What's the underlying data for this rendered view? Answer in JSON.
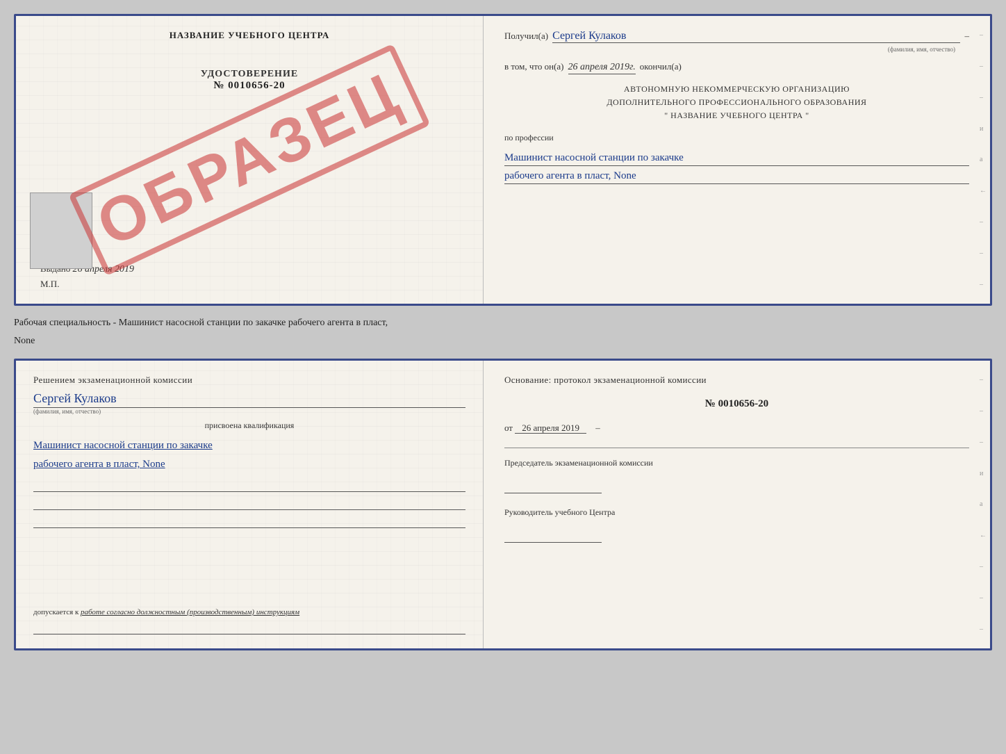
{
  "top_doc": {
    "left": {
      "center_title": "НАЗВАНИЕ УЧЕБНОГО ЦЕНТРА",
      "udostoverenie_label": "УДОСТОВЕРЕНИЕ",
      "nomer": "№ 0010656-20",
      "vydano_label": "Выдано",
      "vydano_date": "26 апреля 2019",
      "mp_label": "М.П.",
      "obrazec": "ОБРАЗЕЦ"
    },
    "right": {
      "poluchil_label": "Получил(а)",
      "poluchil_name": "Сергей Кулаков",
      "name_hint": "(фамилия, имя, отчество)",
      "vtom_label": "в том, что он(а)",
      "vtom_date": "26 апреля 2019г.",
      "okonchil_label": "окончил(а)",
      "org_line1": "АВТОНОМНУЮ НЕКОММЕРЧЕСКУЮ ОРГАНИЗАЦИЮ",
      "org_line2": "ДОПОЛНИТЕЛЬНОГО ПРОФЕССИОНАЛЬНОГО ОБРАЗОВАНИЯ",
      "org_line3": "\"   НАЗВАНИЕ УЧЕБНОГО ЦЕНТРА   \"",
      "po_professii_label": "по профессии",
      "profession_line1": "Машинист насосной станции по закачке",
      "profession_line2": "рабочего агента в пласт, None"
    }
  },
  "specialty_text": "Рабочая специальность - Машинист насосной станции по закачке рабочего агента в пласт,",
  "specialty_text2": "None",
  "bottom_doc": {
    "left": {
      "resheniem_text": "Решением экзаменационной комиссии",
      "name": "Сергей Кулаков",
      "name_hint": "(фамилия, имя, отчество)",
      "prisvoena_label": "присвоена квалификация",
      "qualification_line1": "Машинист насосной станции по закачке",
      "qualification_line2": "рабочего агента в пласт, None",
      "dopuskaetsya_label": "допускается к",
      "dopuskaetsya_value": "работе согласно должностным (производственным) инструкциям"
    },
    "right": {
      "osnov_label": "Основание: протокол экзаменационной комиссии",
      "nomer": "№  0010656-20",
      "ot_label": "от",
      "ot_date": "26 апреля 2019",
      "predsedatel_label": "Председатель экзаменационной комиссии",
      "rukovoditel_label": "Руководитель учебного Центра"
    }
  },
  "side_dashes": [
    "–",
    "–",
    "–",
    "и",
    "а",
    "←",
    "–",
    "–",
    "–",
    "–"
  ]
}
